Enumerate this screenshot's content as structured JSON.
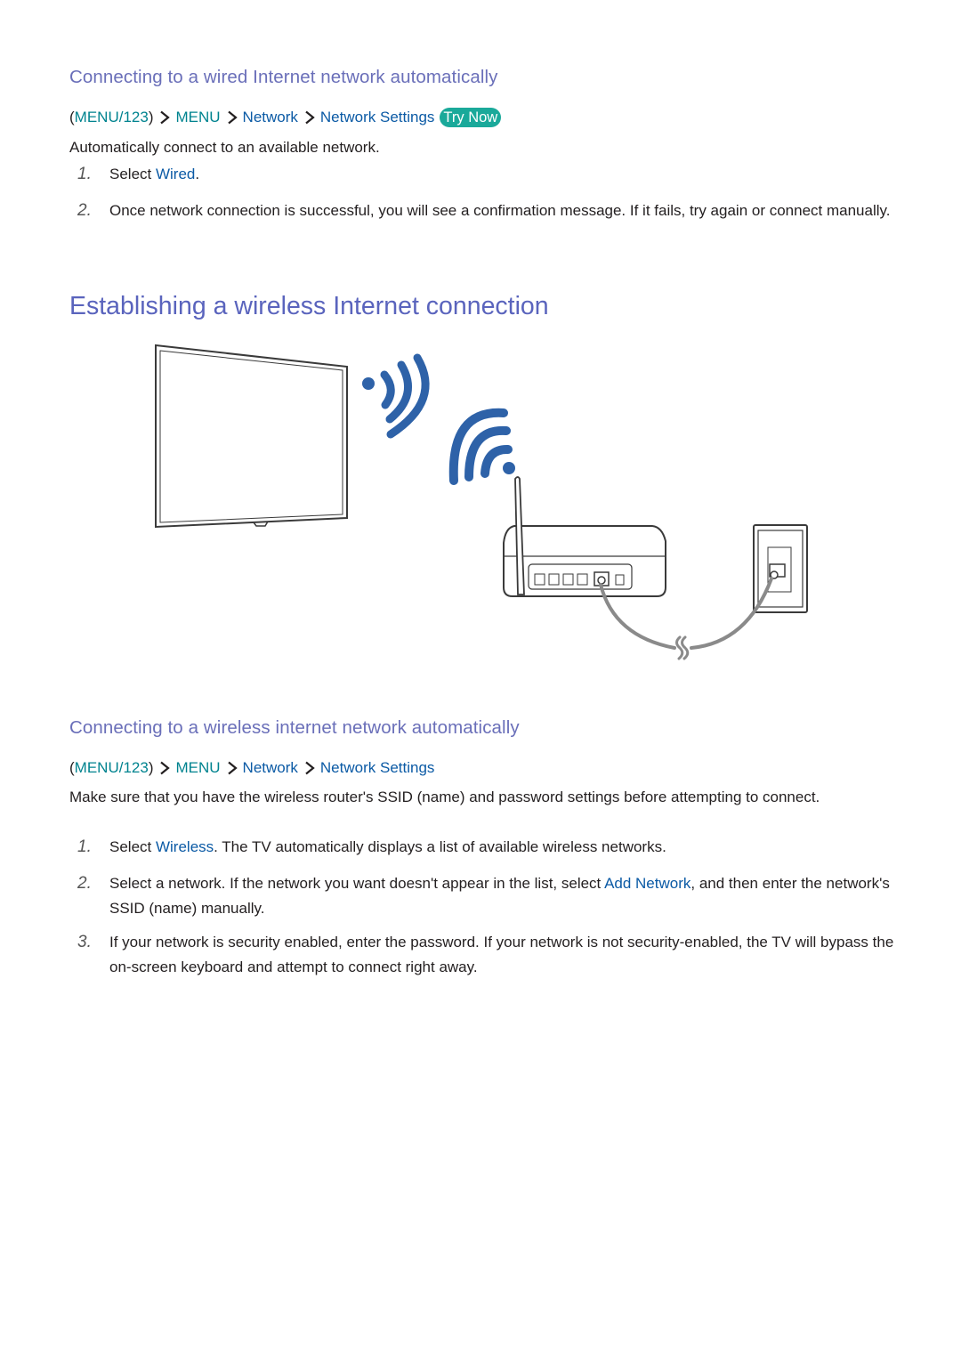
{
  "section_wired": {
    "heading": "Connecting to a wired Internet network automatically",
    "path": {
      "paren_open": "(",
      "item1": "MENU/123",
      "paren_close": ")",
      "item2": "MENU",
      "item3": "Network",
      "item4": "Network Settings",
      "try_now": "Try Now"
    },
    "intro": "Automatically connect to an available network.",
    "steps": [
      {
        "num": "1.",
        "pre": "Select ",
        "link": "Wired",
        "post": "."
      },
      {
        "num": "2.",
        "text": "Once network connection is successful, you will see a confirmation message. If it fails, try again or connect manually."
      }
    ]
  },
  "section_wireless": {
    "title": "Establishing a wireless Internet connection",
    "illustration": {
      "description": "TV with wireless signal, wireless router with antenna connected by cable to wall LAN port",
      "signal_color": "#2e62a8"
    },
    "subheading": "Connecting to a wireless internet network automatically",
    "path": {
      "paren_open": "(",
      "item1": "MENU/123",
      "paren_close": ")",
      "item2": "MENU",
      "item3": "Network",
      "item4": "Network Settings"
    },
    "intro": "Make sure that you have the wireless router's SSID (name) and password settings before attempting to connect.",
    "steps": [
      {
        "num": "1.",
        "pre": "Select ",
        "link": "Wireless",
        "post": ". The TV automatically displays a list of available wireless networks."
      },
      {
        "num": "2.",
        "pre": "Select a network. If the network you want doesn't appear in the list, select ",
        "link": "Add Network",
        "post": ", and then enter the network's SSID (name) manually."
      },
      {
        "num": "3.",
        "text": "If your network is security enabled, enter the password. If your network is not security-enabled, the TV will bypass the on-screen keyboard and attempt to connect right away."
      }
    ]
  }
}
